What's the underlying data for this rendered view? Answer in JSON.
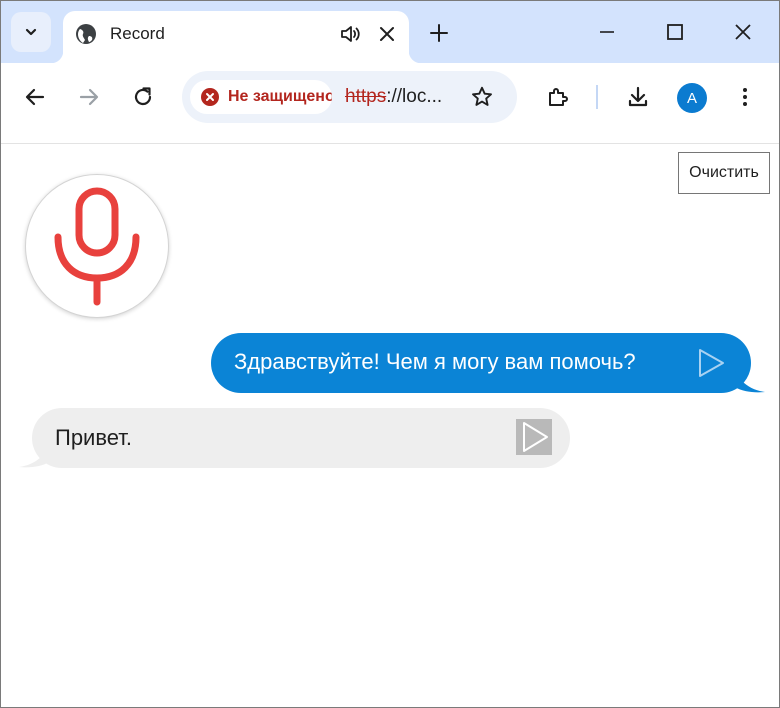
{
  "browser": {
    "tab": {
      "title": "Record",
      "favicon": "globe-icon",
      "audio_icon": "speaker-icon",
      "close_icon": "close-icon"
    },
    "new_tab_icon": "plus-icon",
    "window_controls": [
      "minimize-icon",
      "maximize-icon",
      "close-icon"
    ],
    "toolbar": {
      "back_icon": "arrow-left-icon",
      "forward_icon": "arrow-right-icon",
      "reload_icon": "reload-icon",
      "security_label": "Не защищено",
      "url_scheme": "https",
      "url_rest": "://loc...",
      "bookmark_icon": "star-icon",
      "extensions_icon": "puzzle-icon",
      "downloads_icon": "download-icon",
      "profile_initial": "A",
      "menu_icon": "kebab-menu-icon"
    },
    "colors": {
      "titlebar": "#d3e3fd",
      "security_red": "#b3261e",
      "profile_blue": "#0b7bd0"
    }
  },
  "page": {
    "clear_button_label": "Очистить",
    "mic_icon": "microphone-icon",
    "messages": [
      {
        "role": "assistant",
        "text": "Здравствуйте! Чем я могу вам помочь?",
        "play_icon": "play-icon"
      },
      {
        "role": "user",
        "text": "Привет.",
        "play_icon": "play-icon"
      }
    ],
    "colors": {
      "assistant_bubble": "#0b84d6",
      "user_bubble": "#eeeeee",
      "mic_red": "#e8413d"
    }
  }
}
